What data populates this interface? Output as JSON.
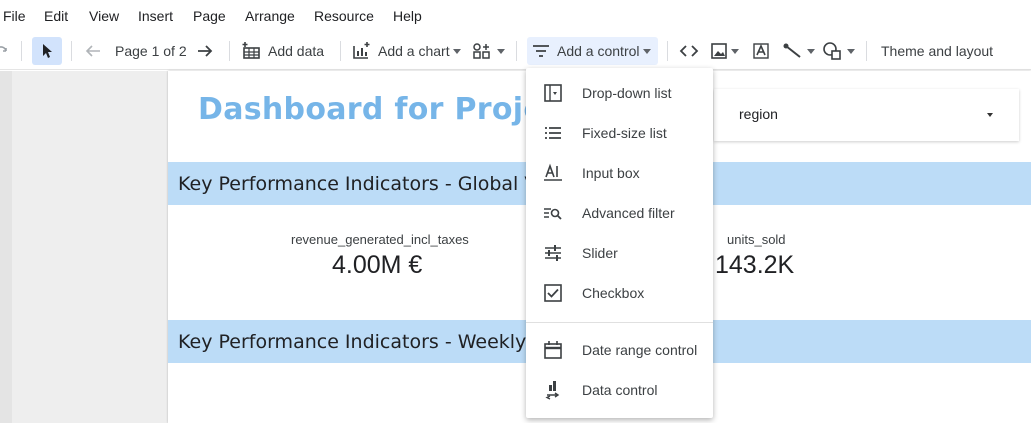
{
  "menubar": {
    "items": [
      "File",
      "Edit",
      "View",
      "Insert",
      "Page",
      "Arrange",
      "Resource",
      "Help"
    ]
  },
  "toolbar": {
    "page_indicator": "Page 1 of 2",
    "add_data_label": "Add data",
    "add_chart_label": "Add a chart",
    "add_control_label": "Add a control",
    "theme_label": "Theme and layout"
  },
  "report": {
    "title": "Dashboard for Project",
    "filter_label": "region",
    "band_global": "Key Performance Indicators - Global V",
    "band_weekly": "Key Performance Indicators - Weekly",
    "kpi_revenue_label": "revenue_generated_incl_taxes",
    "kpi_revenue_value": "4.00M €",
    "kpi_units_label": "units_sold",
    "kpi_units_value": "143.2K"
  },
  "control_menu": {
    "items": [
      {
        "label": "Drop-down list",
        "icon": "dropdown-list-icon"
      },
      {
        "label": "Fixed-size list",
        "icon": "list-icon"
      },
      {
        "label": "Input box",
        "icon": "input-box-icon"
      },
      {
        "label": "Advanced filter",
        "icon": "advanced-filter-icon"
      },
      {
        "label": "Slider",
        "icon": "slider-icon"
      },
      {
        "label": "Checkbox",
        "icon": "checkbox-icon"
      },
      {
        "label": "Date range control",
        "icon": "calendar-icon"
      },
      {
        "label": "Data control",
        "icon": "data-control-icon"
      }
    ]
  },
  "colors": {
    "title_blue": "#76b5e8",
    "band_blue": "#bcdcf7",
    "active_button": "#d2e3fc"
  }
}
